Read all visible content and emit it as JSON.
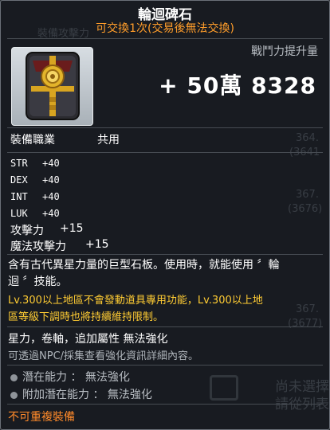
{
  "background_ghost_text": [
    "裝備攻擊力",
    "364.",
    "364.",
    "(3641",
    "367.",
    "(3676)",
    "367.",
    "(3677)",
    "尚未選擇",
    "請從列表"
  ],
  "item": {
    "name": "輪迴碑石",
    "trade_note": "可交換1次(交易後無法交換)",
    "icon": "black-stone-tablet-icon",
    "power_label": "戰鬥力提升量",
    "power_value": "+ 50萬 8328",
    "job_label": "裝備職業",
    "job_value": "共用",
    "stats": [
      {
        "name": "STR",
        "value": "+40"
      },
      {
        "name": "DEX",
        "value": "+40"
      },
      {
        "name": "INT",
        "value": "+40"
      },
      {
        "name": "LUK",
        "value": "+40"
      }
    ],
    "attack": {
      "label": "攻擊力",
      "value": "+15"
    },
    "magic_attack": {
      "label": "魔法攻擊力",
      "value": "+15"
    },
    "description": [
      "含有古代異星力量的巨型石板。使用時，就能使用 〞輪",
      "迴 〞技能。"
    ],
    "warning": [
      "Lv.300以上地區不會發動道具專用功能，Lv.300以上地",
      "區等級下調時也將持續維持限制。"
    ],
    "flags": "星力，卷軸，追加屬性 無法強化",
    "hint": "可透過NPC/採集查看強化資訊詳細內容。",
    "potential": "潛在能力 ： 無法強化",
    "bonus_potential": "附加潛在能力 ： 無法強化",
    "no_duplicate": "不可重複裝備"
  },
  "colors": {
    "orange": "#ff9d2a",
    "yellow": "#ffcc33",
    "panel": "#181b20"
  }
}
